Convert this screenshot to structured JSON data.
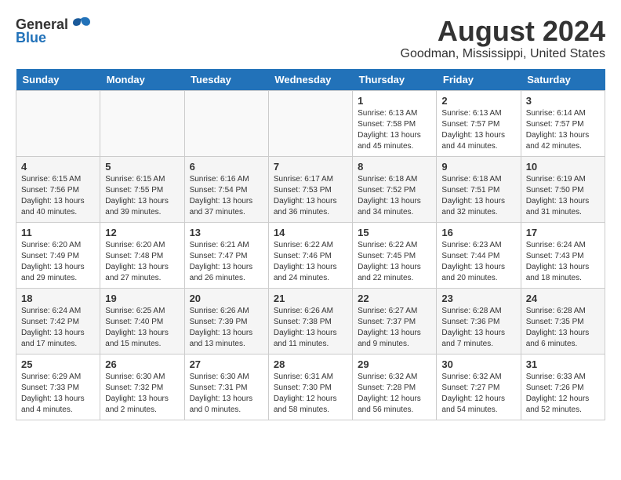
{
  "header": {
    "logo_general": "General",
    "logo_blue": "Blue",
    "month_title": "August 2024",
    "location": "Goodman, Mississippi, United States"
  },
  "calendar": {
    "days_of_week": [
      "Sunday",
      "Monday",
      "Tuesday",
      "Wednesday",
      "Thursday",
      "Friday",
      "Saturday"
    ],
    "weeks": [
      [
        {
          "day": "",
          "empty": true
        },
        {
          "day": "",
          "empty": true
        },
        {
          "day": "",
          "empty": true
        },
        {
          "day": "",
          "empty": true
        },
        {
          "day": "1",
          "sunrise": "6:13 AM",
          "sunset": "7:58 PM",
          "daylight": "13 hours and 45 minutes."
        },
        {
          "day": "2",
          "sunrise": "6:13 AM",
          "sunset": "7:57 PM",
          "daylight": "13 hours and 44 minutes."
        },
        {
          "day": "3",
          "sunrise": "6:14 AM",
          "sunset": "7:57 PM",
          "daylight": "13 hours and 42 minutes."
        }
      ],
      [
        {
          "day": "4",
          "sunrise": "6:15 AM",
          "sunset": "7:56 PM",
          "daylight": "13 hours and 40 minutes."
        },
        {
          "day": "5",
          "sunrise": "6:15 AM",
          "sunset": "7:55 PM",
          "daylight": "13 hours and 39 minutes."
        },
        {
          "day": "6",
          "sunrise": "6:16 AM",
          "sunset": "7:54 PM",
          "daylight": "13 hours and 37 minutes."
        },
        {
          "day": "7",
          "sunrise": "6:17 AM",
          "sunset": "7:53 PM",
          "daylight": "13 hours and 36 minutes."
        },
        {
          "day": "8",
          "sunrise": "6:18 AM",
          "sunset": "7:52 PM",
          "daylight": "13 hours and 34 minutes."
        },
        {
          "day": "9",
          "sunrise": "6:18 AM",
          "sunset": "7:51 PM",
          "daylight": "13 hours and 32 minutes."
        },
        {
          "day": "10",
          "sunrise": "6:19 AM",
          "sunset": "7:50 PM",
          "daylight": "13 hours and 31 minutes."
        }
      ],
      [
        {
          "day": "11",
          "sunrise": "6:20 AM",
          "sunset": "7:49 PM",
          "daylight": "13 hours and 29 minutes."
        },
        {
          "day": "12",
          "sunrise": "6:20 AM",
          "sunset": "7:48 PM",
          "daylight": "13 hours and 27 minutes."
        },
        {
          "day": "13",
          "sunrise": "6:21 AM",
          "sunset": "7:47 PM",
          "daylight": "13 hours and 26 minutes."
        },
        {
          "day": "14",
          "sunrise": "6:22 AM",
          "sunset": "7:46 PM",
          "daylight": "13 hours and 24 minutes."
        },
        {
          "day": "15",
          "sunrise": "6:22 AM",
          "sunset": "7:45 PM",
          "daylight": "13 hours and 22 minutes."
        },
        {
          "day": "16",
          "sunrise": "6:23 AM",
          "sunset": "7:44 PM",
          "daylight": "13 hours and 20 minutes."
        },
        {
          "day": "17",
          "sunrise": "6:24 AM",
          "sunset": "7:43 PM",
          "daylight": "13 hours and 18 minutes."
        }
      ],
      [
        {
          "day": "18",
          "sunrise": "6:24 AM",
          "sunset": "7:42 PM",
          "daylight": "13 hours and 17 minutes."
        },
        {
          "day": "19",
          "sunrise": "6:25 AM",
          "sunset": "7:40 PM",
          "daylight": "13 hours and 15 minutes."
        },
        {
          "day": "20",
          "sunrise": "6:26 AM",
          "sunset": "7:39 PM",
          "daylight": "13 hours and 13 minutes."
        },
        {
          "day": "21",
          "sunrise": "6:26 AM",
          "sunset": "7:38 PM",
          "daylight": "13 hours and 11 minutes."
        },
        {
          "day": "22",
          "sunrise": "6:27 AM",
          "sunset": "7:37 PM",
          "daylight": "13 hours and 9 minutes."
        },
        {
          "day": "23",
          "sunrise": "6:28 AM",
          "sunset": "7:36 PM",
          "daylight": "13 hours and 7 minutes."
        },
        {
          "day": "24",
          "sunrise": "6:28 AM",
          "sunset": "7:35 PM",
          "daylight": "13 hours and 6 minutes."
        }
      ],
      [
        {
          "day": "25",
          "sunrise": "6:29 AM",
          "sunset": "7:33 PM",
          "daylight": "13 hours and 4 minutes."
        },
        {
          "day": "26",
          "sunrise": "6:30 AM",
          "sunset": "7:32 PM",
          "daylight": "13 hours and 2 minutes."
        },
        {
          "day": "27",
          "sunrise": "6:30 AM",
          "sunset": "7:31 PM",
          "daylight": "13 hours and 0 minutes."
        },
        {
          "day": "28",
          "sunrise": "6:31 AM",
          "sunset": "7:30 PM",
          "daylight": "12 hours and 58 minutes."
        },
        {
          "day": "29",
          "sunrise": "6:32 AM",
          "sunset": "7:28 PM",
          "daylight": "12 hours and 56 minutes."
        },
        {
          "day": "30",
          "sunrise": "6:32 AM",
          "sunset": "7:27 PM",
          "daylight": "12 hours and 54 minutes."
        },
        {
          "day": "31",
          "sunrise": "6:33 AM",
          "sunset": "7:26 PM",
          "daylight": "12 hours and 52 minutes."
        }
      ]
    ]
  }
}
